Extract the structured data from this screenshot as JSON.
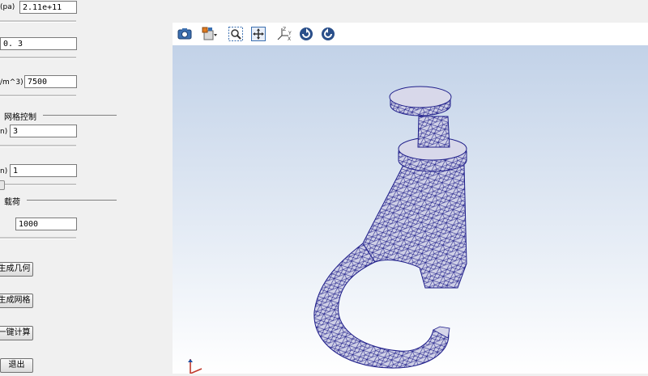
{
  "panel": {
    "material": {
      "modulus_label": "(pa)",
      "modulus_value": "2.11e+11",
      "poisson_value": "0. 3",
      "density_label": "/m^3)",
      "density_value": "7500"
    },
    "mesh_control": {
      "title": "网格控制",
      "field1_label": "n)",
      "field1_value": "3",
      "field2_label": "n)",
      "field2_value": "1"
    },
    "load": {
      "title": "载荷",
      "value": "1000"
    },
    "buttons": {
      "gen_geometry": "生成几何",
      "gen_mesh": "生成网格",
      "compute": "一键计算",
      "exit": "退出"
    }
  },
  "toolbar": {
    "icons": [
      "camera-icon",
      "view-mode-icon",
      "zoom-window-icon",
      "fit-all-icon",
      "axes-icon",
      "rotate-left-icon",
      "rotate-right-icon"
    ]
  },
  "colors": {
    "mesh_fill": "#cfd0e6",
    "mesh_line": "#1f1e8a",
    "bg_top": "#c2d2e8",
    "bg_bottom": "#ffffff"
  }
}
